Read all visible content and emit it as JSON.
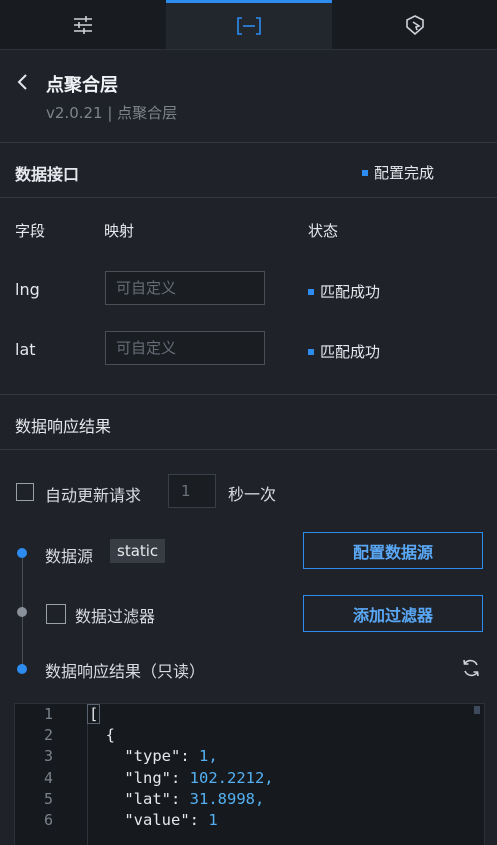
{
  "tabs": [
    {
      "icon": "sliders-icon"
    },
    {
      "icon": "bracket-fit-icon"
    },
    {
      "icon": "cursor-shield-icon"
    }
  ],
  "header": {
    "title": "点聚合层",
    "version": "v2.0.21 | 点聚合层"
  },
  "data_api": {
    "label": "数据接口",
    "status": "配置完成"
  },
  "mapping": {
    "col_field": "字段",
    "col_map": "映射",
    "col_status": "状态",
    "rows": [
      {
        "field": "lng",
        "placeholder": "可自定义",
        "status": "匹配成功"
      },
      {
        "field": "lat",
        "placeholder": "可自定义",
        "status": "匹配成功"
      }
    ]
  },
  "response": {
    "label": "数据响应结果",
    "auto_update_label": "自动更新请求",
    "interval_value": "1",
    "interval_suffix": "秒一次",
    "source_label": "数据源",
    "source_value": "static",
    "config_source_button": "配置数据源",
    "filter_label": "数据过滤器",
    "add_filter_button": "添加过滤器",
    "result_label": "数据响应结果（只读）"
  },
  "editor": {
    "line_numbers": [
      "1",
      "2",
      "3",
      "4",
      "5",
      "6"
    ],
    "lines": [
      {
        "indent": "",
        "key": "[",
        "value": ""
      },
      {
        "indent": "  ",
        "key": "{",
        "value": ""
      },
      {
        "indent": "    ",
        "key": "\"type\": ",
        "value": "1,"
      },
      {
        "indent": "    ",
        "key": "\"lng\": ",
        "value": "102.2212,"
      },
      {
        "indent": "    ",
        "key": "\"lat\": ",
        "value": "31.8998,"
      },
      {
        "indent": "    ",
        "key": "\"value\": ",
        "value": "1"
      }
    ]
  },
  "colors": {
    "accent": "#2d8cf0",
    "background": "#1f2329",
    "number": "#54b0f2"
  }
}
